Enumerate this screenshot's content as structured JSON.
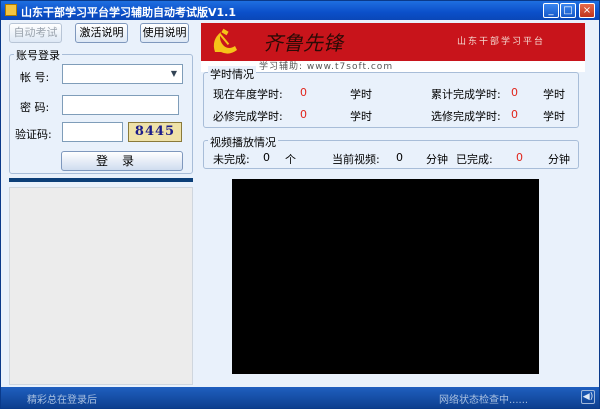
{
  "window": {
    "title": "山东干部学习平台学习辅助自动考试版V1.1",
    "minimize": "_",
    "maximize": "□",
    "close": "×"
  },
  "toolbar": {
    "auto_exam": "自动考试",
    "activation_help": "激活说明",
    "usage_help": "使用说明"
  },
  "login": {
    "group_title": "账号登录",
    "account_label": "帐  号:",
    "password_label": "密  码:",
    "captcha_label": "验证码:",
    "account_value": "",
    "password_value": "",
    "captcha_value": "",
    "captcha_image_text": "8445",
    "login_button": "登录"
  },
  "banner": {
    "brand": "齐鲁先锋",
    "subtitle": "山东干部学习平台",
    "url_text": "学习辅助: www.t7soft.com"
  },
  "study_hours": {
    "group_title": "学时情况",
    "current_year_label": "现在年度学时:",
    "current_year_value": "0",
    "cumulative_label": "累计完成学时:",
    "cumulative_value": "0",
    "required_label": "必修完成学时:",
    "required_value": "0",
    "elective_label": "选修完成学时:",
    "elective_value": "0",
    "unit": "学时"
  },
  "video": {
    "group_title": "视频播放情况",
    "unfinished_label": "未完成:",
    "unfinished_value": "0",
    "unfinished_unit": "个",
    "current_label": "当前视频:",
    "current_value": "0",
    "current_unit": "分钟",
    "done_label": "已完成:",
    "done_value": "0",
    "done_unit": "分钟"
  },
  "status": {
    "left": "精彩总在登录后",
    "right": "网络状态检查中......"
  },
  "colors": {
    "title_bar": "#0b4fc9",
    "value_red": "#e1251b",
    "banner_red": "#c8141b",
    "status_bar": "#0d3f8f"
  },
  "icons": {
    "app": "app-icon",
    "speaker": "speaker-icon",
    "emblem": "party-emblem-icon"
  }
}
